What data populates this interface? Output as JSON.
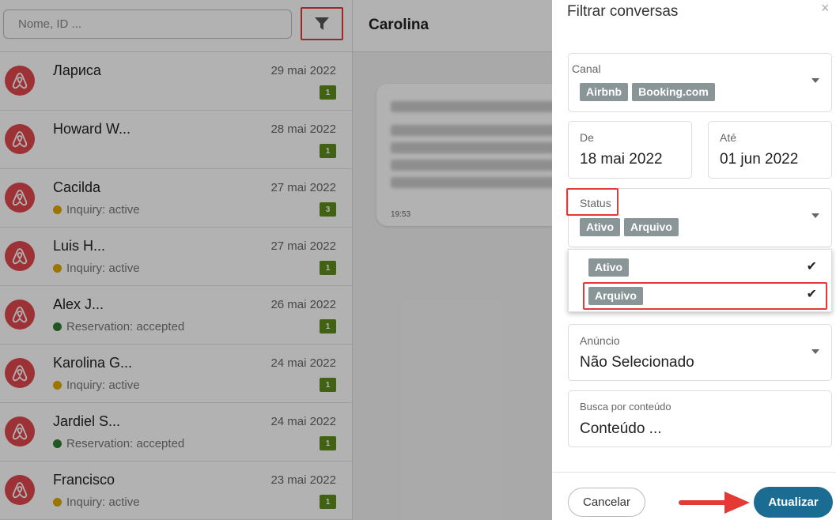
{
  "search": {
    "placeholder": "Nome, ID ..."
  },
  "chat": {
    "title": "Carolina",
    "bubble_time": "19:53"
  },
  "conversations": [
    {
      "name": "Лариса",
      "date": "29 mai 2022",
      "status": "",
      "status_color": "",
      "count": "1"
    },
    {
      "name": "Howard W...",
      "date": "28 mai 2022",
      "status": "",
      "status_color": "",
      "count": "1"
    },
    {
      "name": "Cacilda",
      "date": "27 mai 2022",
      "status": "Inquiry: active",
      "status_color": "#e0a800",
      "count": "3"
    },
    {
      "name": "Luis H...",
      "date": "27 mai 2022",
      "status": "Inquiry: active",
      "status_color": "#e0a800",
      "count": "1"
    },
    {
      "name": "Alex J...",
      "date": "26 mai 2022",
      "status": "Reservation: accepted",
      "status_color": "#2e7d32",
      "count": "1"
    },
    {
      "name": "Karolina G...",
      "date": "24 mai 2022",
      "status": "Inquiry: active",
      "status_color": "#e0a800",
      "count": "1"
    },
    {
      "name": "Jardiel S...",
      "date": "24 mai 2022",
      "status": "Reservation: accepted",
      "status_color": "#2e7d32",
      "count": "1"
    },
    {
      "name": "Francisco",
      "date": "23 mai 2022",
      "status": "Inquiry: active",
      "status_color": "#e0a800",
      "count": "1"
    }
  ],
  "panel": {
    "title": "Filtrar conversas",
    "close": "×",
    "canal": {
      "label": "Canal",
      "chips": [
        "Airbnb",
        "Booking.com"
      ]
    },
    "de": {
      "label": "De",
      "value": "18 mai 2022"
    },
    "ate": {
      "label": "Até",
      "value": "01 jun 2022"
    },
    "status": {
      "label": "Status",
      "chips": [
        "Ativo",
        "Arquivo"
      ]
    },
    "status_options": [
      {
        "label": "Ativo",
        "check": "✔"
      },
      {
        "label": "Arquivo",
        "check": "✔"
      }
    ],
    "anuncio": {
      "label": "Anúncio",
      "value": "Não Selecionado"
    },
    "busca": {
      "label": "Busca por conteúdo",
      "placeholder": "Conteúdo ..."
    },
    "cancel_label": "Cancelar",
    "update_label": "Atualizar"
  },
  "colors": {
    "accent": "#1a6c93",
    "airbnb": "#e0484e",
    "badge": "#5e8c1c",
    "highlight": "#e53935"
  },
  "icons": {
    "filter": "filter-icon",
    "airbnb": "airbnb-logo-icon",
    "caret": "caret-down-icon",
    "check": "check-icon"
  }
}
